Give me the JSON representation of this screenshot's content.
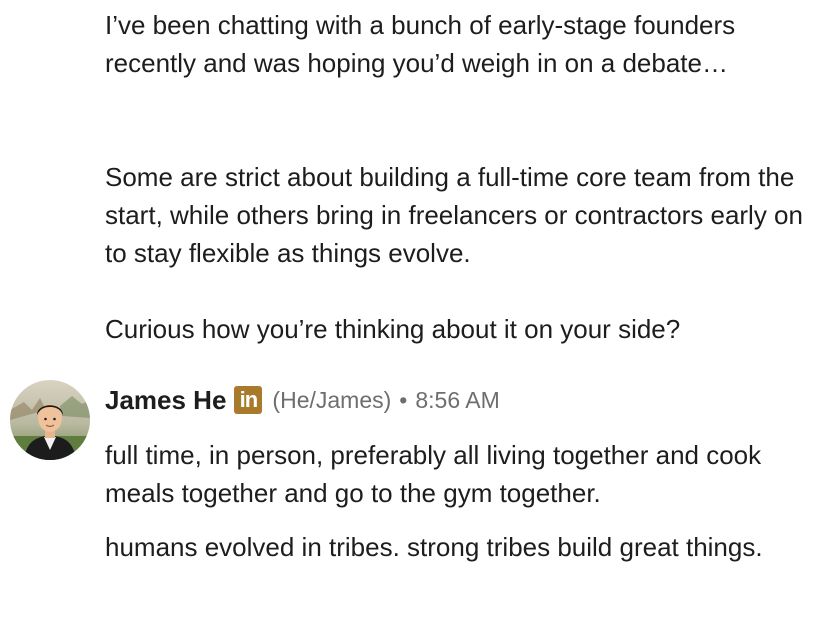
{
  "previous_message": {
    "paragraphs": [
      "I’ve been chatting with a bunch of early-stage founders recently and was hoping you’d weigh in on a debate…",
      "Some are strict about building a full-time core team from the start, while others bring in freelancers or contractors early on to stay flexible as things evolve.",
      "Curious how you’re thinking about it on your side?"
    ]
  },
  "reply": {
    "sender_name": "James He",
    "badge_label": "in",
    "pronouns": "(He/James)",
    "separator": "•",
    "timestamp": "8:56 AM",
    "paragraphs": [
      "full time, in person, preferably all living together and cook meals together and go to the gym together.",
      "humans evolved in tribes. strong tribes build great things."
    ]
  },
  "colors": {
    "text_primary": "#1d1d1f",
    "text_secondary": "#6e6e6e",
    "linkedin_badge": "#a87b2c"
  },
  "icons": {
    "avatar": "profile-photo",
    "badge": "linkedin-icon"
  }
}
